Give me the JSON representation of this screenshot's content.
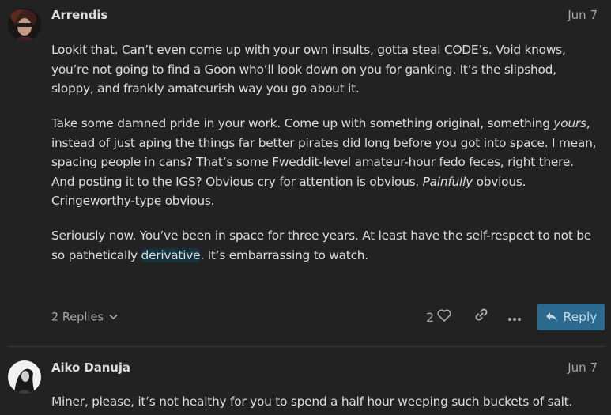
{
  "posts": [
    {
      "username": "Arrendis",
      "date": "Jun 7",
      "paragraphs": {
        "p1": "Lookit that. Can’t even come up with your own insults, gotta steal CODE’s. Void knows, you’re not going to find a Goon who’ll look down on you for ganking. It’s the slipshod, sloppy, and frankly amateurish way you go about it.",
        "p2_a": "Take some damned pride in your work. Come up with something original, something ",
        "p2_em1": "yours",
        "p2_b": ", instead of just aping the things far better pirates did long before you got into space. I mean, spacing people in cans? That’s some Fweddit-level amateur-hour fedo feces, right there. And posting it to the IGS? Obvious cry for attention is obvious. ",
        "p2_em2": "Painfully",
        "p2_c": " obvious. Cringeworthy-type obvious.",
        "p3_a": "Seriously now. You’ve been in space for three years. At least have the self-respect to not be so pathetically ",
        "p3_hl": "derivative",
        "p3_b": ". It’s embarrassing to watch."
      },
      "replies_label": "2 Replies",
      "like_count": "2",
      "reply_label": "Reply"
    },
    {
      "username": "Aiko Danuja",
      "date": "Jun 7",
      "text": "Miner, please, it’s not healthy for you to spend a half hour weeping such buckets of salt."
    }
  ],
  "icons": {
    "chevron": "chevron-down-icon",
    "like": "heart-icon",
    "link": "link-icon",
    "more": "ellipsis-icon",
    "reply": "reply-arrow-icon"
  },
  "colors": {
    "background": "#222222",
    "text": "#dddddd",
    "muted": "#a8a8a8",
    "reply_button": "#2b6a8e",
    "highlight": "#14323d"
  }
}
